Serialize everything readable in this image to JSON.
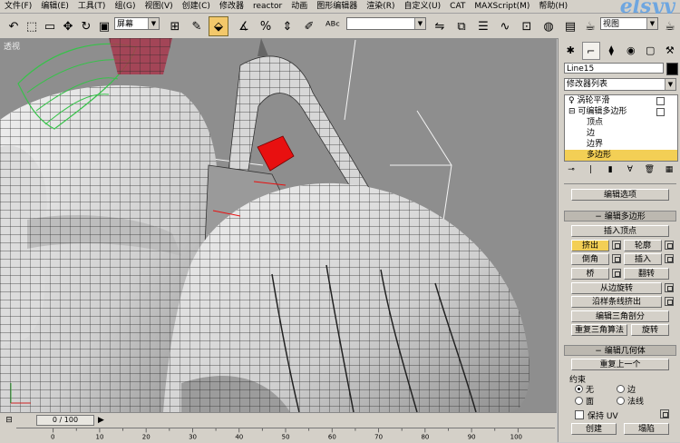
{
  "menu": [
    "文件(F)",
    "编辑(E)",
    "工具(T)",
    "组(G)",
    "视图(V)",
    "创建(C)",
    "修改器",
    "reactor",
    "动画",
    "图形编辑器",
    "渲染(R)",
    "自定义(U)",
    "CAT",
    "MAXScript(M)",
    "帮助(H)"
  ],
  "logo": "elsyy",
  "toolbar": {
    "selection_filter": "屏幕",
    "named_selection": "",
    "view_dropdown": "视图"
  },
  "viewport": {
    "label": "透视"
  },
  "panel": {
    "object_name": "Line15",
    "modifier_list": "修改器列表",
    "stack": [
      {
        "label": "涡轮平滑"
      },
      {
        "label": "可编辑多边形"
      },
      {
        "label": "顶点"
      },
      {
        "label": "边"
      },
      {
        "label": "边界"
      },
      {
        "label": "多边形"
      }
    ],
    "top_button": "编辑选项",
    "edit_poly_title": "编辑多边形",
    "insert_vertex": "插入顶点",
    "extrude": "挤出",
    "outline": "轮廓",
    "bevel": "倒角",
    "inset": "插入",
    "bridge": "桥",
    "flip": "翻转",
    "hinge_from_edge": "从边旋转",
    "extrude_along_spline": "沿样条线挤出",
    "edit_triangulation": "编辑三角剖分",
    "retriangulate": "重复三角算法",
    "turn": "旋转",
    "edit_geometry_title": "编辑几何体",
    "repeat_last": "重复上一个",
    "constraints": "约束",
    "c_none": "无",
    "c_edge": "边",
    "c_face": "面",
    "c_normal": "法线",
    "preserve_uv": "保持 UV",
    "create": "创建",
    "collapse": "塌陷"
  },
  "timeline": {
    "frame": "0 / 100",
    "ticks": [
      "0",
      "10",
      "20",
      "30",
      "40",
      "50",
      "60",
      "70",
      "80",
      "90",
      "100"
    ]
  }
}
